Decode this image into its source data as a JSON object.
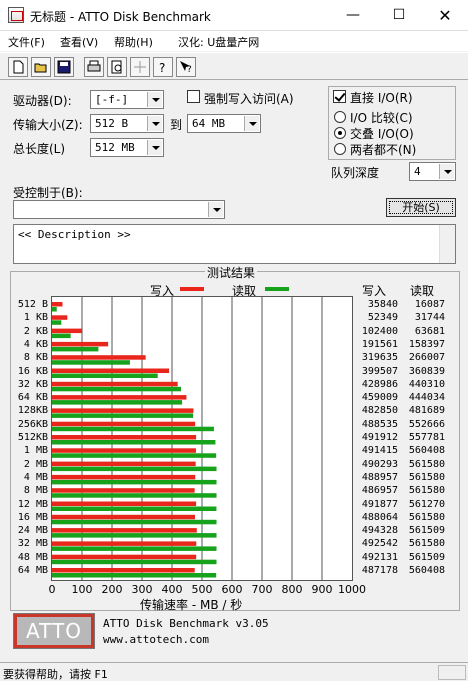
{
  "window": {
    "title": "无标题 - ATTO Disk Benchmark"
  },
  "menu": [
    "文件(F)",
    "查看(V)",
    "帮助(H)",
    "汉化: U盘量产网"
  ],
  "toolbar_icons": [
    "new-file-icon",
    "open-folder-icon",
    "save-icon",
    "print-icon",
    "print-preview-icon",
    "move-icon",
    "help-icon",
    "context-help-icon"
  ],
  "form": {
    "drive_label": "驱动器(D):",
    "drive_value": "[-f-]",
    "force_write_label": "强制写入访问(A)",
    "transfer_size_label": "传输大小(Z):",
    "transfer_from": "512 B",
    "to_label": "到",
    "transfer_to": "64 MB",
    "total_length_label": "总长度(L)",
    "total_length": "512 MB",
    "direct_io_label": "直接 I/O(R)",
    "io_compare_label": "I/O 比较(C)",
    "overlap_io_label": "交叠 I/O(O)",
    "neither_label": "两者都不(N)",
    "queue_depth_label": "队列深度",
    "queue_depth": "4",
    "controlled_by_label": "受控制于(B):",
    "controlled_by_value": "",
    "start_button": "开始(S)",
    "description": "<< Description >>"
  },
  "results": {
    "title": "测试结果",
    "write_legend": "写入",
    "read_legend": "读取",
    "write_col": "写入",
    "read_col": "读取",
    "xlabel": "传输速率 - MB / 秒",
    "write_color": "#e8261c",
    "read_color": "#16a21a"
  },
  "chart_data": {
    "type": "bar",
    "orientation": "horizontal",
    "categories": [
      "512 B",
      "1 KB",
      "2 KB",
      "4 KB",
      "8 KB",
      "16 KB",
      "32 KB",
      "64 KB",
      "128KB",
      "256KB",
      "512KB",
      "1 MB",
      "2 MB",
      "4 MB",
      "8 MB",
      "12 MB",
      "16 MB",
      "24 MB",
      "32 MB",
      "48 MB",
      "64 MB"
    ],
    "series": [
      {
        "name": "写入",
        "values": [
          35840,
          52349,
          102400,
          191561,
          319635,
          399507,
          428986,
          459009,
          482850,
          488535,
          491912,
          491415,
          490293,
          488957,
          486957,
          491877,
          488064,
          494328,
          492542,
          492131,
          487178
        ]
      },
      {
        "name": "读取",
        "values": [
          16087,
          31744,
          63681,
          158397,
          266007,
          360839,
          440310,
          444034,
          481689,
          552666,
          557781,
          560408,
          561580,
          561580,
          561580,
          561270,
          561580,
          561509,
          561580,
          561509,
          560408
        ]
      }
    ],
    "xticks": [
      "0",
      "100",
      "200",
      "300",
      "400",
      "500",
      "600",
      "700",
      "800",
      "900",
      "1000"
    ],
    "xlim": [
      0,
      1000
    ],
    "xlabel": "传输速率 - MB / 秒",
    "grid": true
  },
  "footer": {
    "logo": "ATTO",
    "product": "ATTO Disk Benchmark v3.05",
    "url": "www.attotech.com"
  },
  "status": {
    "text": "要获得帮助，请按 F1"
  }
}
